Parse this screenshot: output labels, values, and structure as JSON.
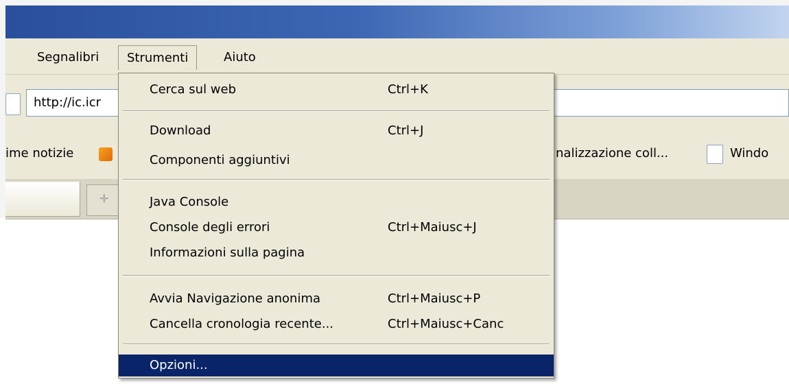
{
  "menubar": {
    "items": [
      {
        "label": "Segnalibri"
      },
      {
        "label": "Strumenti"
      },
      {
        "label": "Aiuto"
      }
    ]
  },
  "navbar": {
    "url": "http://ic.icr"
  },
  "bookmarks": {
    "left_label": "ime notizie",
    "right_label": "nalizzazione coll...",
    "right2_label": "Windo"
  },
  "tools_menu": {
    "groups": [
      [
        {
          "label": "Cerca sul web",
          "shortcut": "Ctrl+K"
        }
      ],
      [
        {
          "label": "Download",
          "shortcut": "Ctrl+J"
        },
        {
          "label": "Componenti aggiuntivi",
          "shortcut": ""
        }
      ],
      [
        {
          "label": "Java Console",
          "shortcut": ""
        },
        {
          "label": "Console degli errori",
          "shortcut": "Ctrl+Maiusc+J"
        },
        {
          "label": "Informazioni sulla pagina",
          "shortcut": ""
        }
      ],
      [
        {
          "label": "Avvia Navigazione anonima",
          "shortcut": "Ctrl+Maiusc+P"
        },
        {
          "label": "Cancella cronologia recente...",
          "shortcut": "Ctrl+Maiusc+Canc"
        }
      ],
      [
        {
          "label": "Opzioni...",
          "shortcut": "",
          "highlighted": true
        }
      ]
    ]
  },
  "colors": {
    "menu_bg": "#ece9d8",
    "highlight": "#0a246a",
    "titlebar": "#3c67b4"
  }
}
